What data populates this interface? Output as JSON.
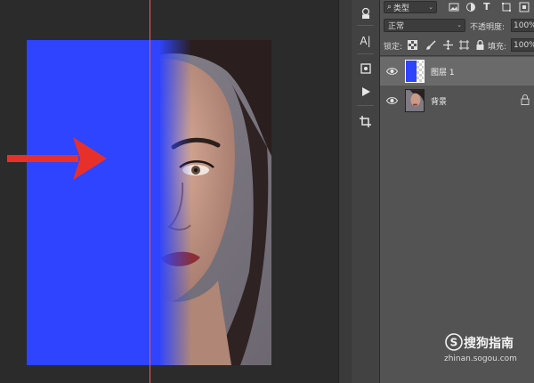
{
  "layers_panel": {
    "filter": {
      "kind_label": "类型",
      "icons": [
        "image-filter-icon",
        "adjustment-filter-icon",
        "type-filter-icon",
        "shape-filter-icon",
        "smart-object-filter-icon"
      ]
    },
    "blend_mode": "正常",
    "opacity_label": "不透明度:",
    "opacity_value": "100%",
    "lock_label": "锁定:",
    "lock_icons": [
      "lock-transparent-icon",
      "lock-image-icon",
      "lock-position-icon",
      "lock-artboard-icon",
      "lock-all-icon"
    ],
    "fill_label": "填充:",
    "fill_value": "100%",
    "layers": [
      {
        "name": "图层 1",
        "selected": true,
        "thumb_color": "#2e44ff"
      },
      {
        "name": "背景",
        "selected": false,
        "locked": true
      }
    ]
  },
  "toolbar": {
    "tools": [
      "3d-icon",
      "character-panel-icon",
      "cube-icon",
      "play-icon",
      "crop-icon"
    ],
    "character_label": "A|"
  },
  "canvas": {
    "fill_color": "#2e44ff",
    "arrow_color": "#e8302a",
    "guide_color": "#ff5a5a"
  },
  "watermark": {
    "title": "搜狗指南",
    "url": "zhinan.sogou.com"
  }
}
